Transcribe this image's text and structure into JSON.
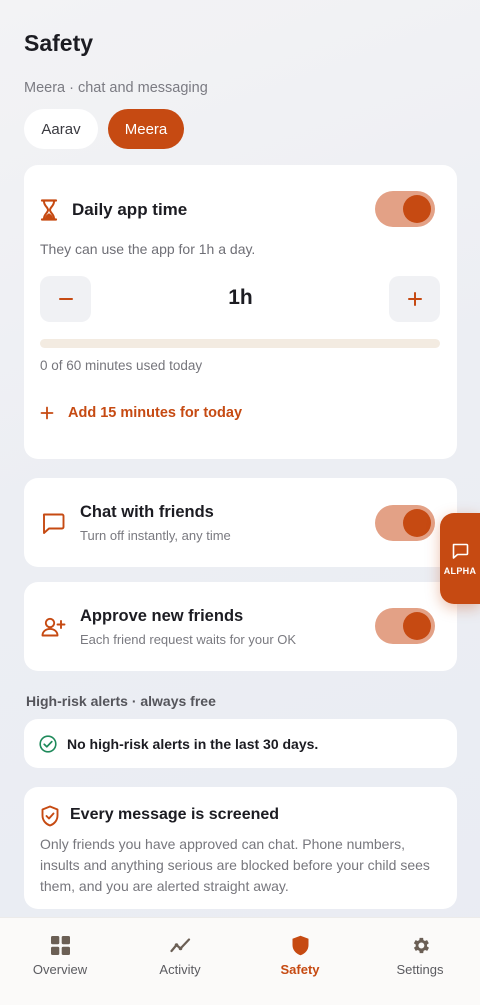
{
  "header": {
    "title": "Safety",
    "subtitle": "Meera · chat and messaging"
  },
  "children": [
    {
      "name": "Aarav",
      "selected": false
    },
    {
      "name": "Meera",
      "selected": true
    }
  ],
  "daily_time": {
    "title": "Daily app time",
    "enabled": true,
    "description": "They can use the app for 1h a day.",
    "value": "1h",
    "used_minutes": 0,
    "total_minutes": 60,
    "usage_text": "0 of 60 minutes used today",
    "add_label": "Add 15 minutes for today"
  },
  "chat": {
    "title": "Chat with friends",
    "subtitle": "Turn off instantly, any time",
    "enabled": true
  },
  "approve": {
    "title": "Approve new friends",
    "subtitle": "Each friend request waits for your OK",
    "enabled": true
  },
  "alerts": {
    "section_label": "High-risk alerts · always free",
    "status_text": "No high-risk alerts in the last 30 days."
  },
  "screening": {
    "title": "Every message is screened",
    "body": "Only friends you have approved can chat. Phone numbers, insults and anything serious are blocked before your child sees them, and you are alerted straight away."
  },
  "alpha_button": {
    "label": "ALPHA"
  },
  "nav": [
    {
      "label": "Overview",
      "icon": "grid-icon",
      "active": false
    },
    {
      "label": "Activity",
      "icon": "activity-icon",
      "active": false
    },
    {
      "label": "Safety",
      "icon": "shield-icon",
      "active": true
    },
    {
      "label": "Settings",
      "icon": "gear-icon",
      "active": false
    }
  ],
  "colors": {
    "accent": "#c64a12",
    "toggle_track": "#e3a186",
    "progress_track": "#f3ebe1",
    "success": "#1f8a5b"
  }
}
